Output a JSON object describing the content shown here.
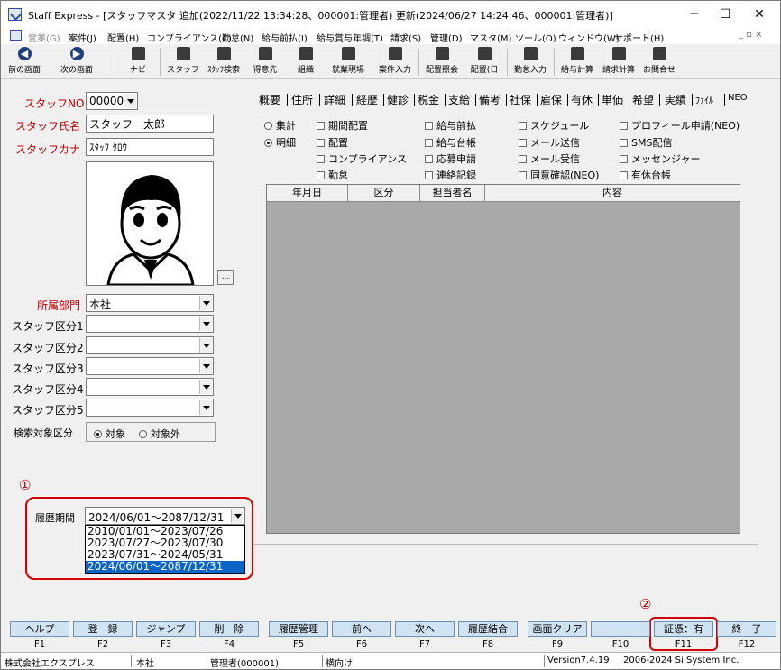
{
  "window": {
    "title": "Staff Express - [スタッフマスタ 追加(2022/11/22 13:34:28、000001:管理者) 更新(2024/06/27 14:24:46、000001:管理者)]",
    "minimize": "─",
    "maximize": "☐",
    "close": "✕"
  },
  "menubar": {
    "items": [
      {
        "label": "営業(G)",
        "disabled": true
      },
      {
        "label": "案件(J)"
      },
      {
        "label": "配置(H)"
      },
      {
        "label": "コンプライアンス(C)"
      },
      {
        "label": "勤怠(N)"
      },
      {
        "label": "給与前払(I)"
      },
      {
        "label": "給与賞与年調(T)"
      },
      {
        "label": "請求(S)"
      },
      {
        "label": "管理(D)"
      },
      {
        "label": "マスタ(M)"
      },
      {
        "label": "ツール(O)"
      },
      {
        "label": "ウィンドウ(W)"
      },
      {
        "label": "サポート(H)"
      }
    ],
    "mdi_controls": "_ ▫ ×"
  },
  "toolbar": {
    "items": [
      {
        "label": "前の画面",
        "icon": "arrow-left-icon"
      },
      {
        "label": "次の画面",
        "icon": "arrow-right-icon"
      },
      {
        "label": "ナビ",
        "icon": "navi-icon"
      },
      {
        "label": "スタッフ",
        "icon": "staff-icon"
      },
      {
        "label": "ｽﾀｯﾌ検索",
        "icon": "staff-search-icon"
      },
      {
        "label": "得意先",
        "icon": "customer-icon"
      },
      {
        "label": "組織",
        "icon": "organization-icon"
      },
      {
        "label": "就業現場",
        "icon": "worksite-icon"
      },
      {
        "label": "案件入力",
        "icon": "job-input-icon"
      },
      {
        "label": "配置照会",
        "icon": "assignment-inquiry-icon"
      },
      {
        "label": "配置(日",
        "icon": "assignment-daily-icon"
      },
      {
        "label": "勤怠入力",
        "icon": "attendance-input-icon"
      },
      {
        "label": "給与計算",
        "icon": "payroll-icon"
      },
      {
        "label": "請求計算",
        "icon": "billing-icon"
      },
      {
        "label": "お問合せ",
        "icon": "inquiry-icon"
      }
    ]
  },
  "form": {
    "staff_no_label": "スタッフNO",
    "staff_no_value": "000005",
    "staff_name_label": "スタッフ氏名",
    "staff_name_value": "スタッフ　太郎",
    "staff_kana_label": "スタッフカナ",
    "staff_kana_value": "ｽﾀｯﾌ ﾀﾛｳ",
    "photo_button": "...",
    "dept_label": "所属部門",
    "dept_value": "本社",
    "categories": [
      {
        "label": "スタッフ区分1",
        "value": ""
      },
      {
        "label": "スタッフ区分2",
        "value": ""
      },
      {
        "label": "スタッフ区分3",
        "value": ""
      },
      {
        "label": "スタッフ区分4",
        "value": ""
      },
      {
        "label": "スタッフ区分5",
        "value": ""
      }
    ],
    "search_target_label": "検索対象区分",
    "search_target_options": [
      "対象",
      "対象外"
    ],
    "search_target_selected": "対象"
  },
  "history": {
    "marker": "①",
    "label": "履歴期間",
    "selected": "2024/06/01～2087/12/31",
    "options": [
      "2010/01/01～2023/07/26",
      "2023/07/27～2023/07/30",
      "2023/07/31～2024/05/31",
      "2024/06/01～2087/12/31"
    ]
  },
  "tabs": [
    "概要",
    "住所",
    "詳細",
    "経歴",
    "健診",
    "税金",
    "支給",
    "備考",
    "社保",
    "雇保",
    "有休",
    "単価",
    "希望",
    "実績",
    "ﾌｧｲﾙ",
    "NEO"
  ],
  "tabs_active": "実績",
  "mode": {
    "options": [
      "集計",
      "明細"
    ],
    "selected": "明細"
  },
  "checkboxes": [
    [
      "期間配置",
      "配置",
      "コンプライアンス",
      "勤怠"
    ],
    [
      "給与前払",
      "給与台帳",
      "応募申請",
      "連絡記録"
    ],
    [
      "スケジュール",
      "メール送信",
      "メール受信",
      "同意確認(NEO)"
    ],
    [
      "プロフィール申請(NEO)",
      "SMS配信",
      "メッセンジャー",
      "有休台帳"
    ]
  ],
  "grid": {
    "columns": [
      "年月日",
      "区分",
      "担当者名",
      "内容"
    ]
  },
  "fkeys": {
    "marker": "②",
    "buttons": [
      {
        "label": "ヘルプ",
        "key": "F1"
      },
      {
        "label": "登　録",
        "key": "F2"
      },
      {
        "label": "ジャンプ",
        "key": "F3"
      },
      {
        "label": "削　除",
        "key": "F4"
      },
      {
        "label": "履歴管理",
        "key": "F5"
      },
      {
        "label": "前へ",
        "key": "F6"
      },
      {
        "label": "次へ",
        "key": "F7"
      },
      {
        "label": "履歴結合",
        "key": "F8"
      },
      {
        "label": "画面クリア",
        "key": "F9"
      },
      {
        "label": "",
        "key": "F10"
      },
      {
        "label": "証憑：有",
        "key": "F11"
      },
      {
        "label": "終　了",
        "key": "F12"
      }
    ]
  },
  "status": {
    "company": "株式会社エクスプレス",
    "dept": "本社",
    "user": "管理者(000001)",
    "mode": "横向け",
    "version": "Version7.4.19",
    "copyright": "2006-2024 Si System Inc."
  },
  "colors": {
    "required_label": "#c00000",
    "annotation": "#d40000",
    "fkey_button": "#cfe3f3",
    "selection": "#0b64c8",
    "grid_background": "#a9a9a9"
  }
}
